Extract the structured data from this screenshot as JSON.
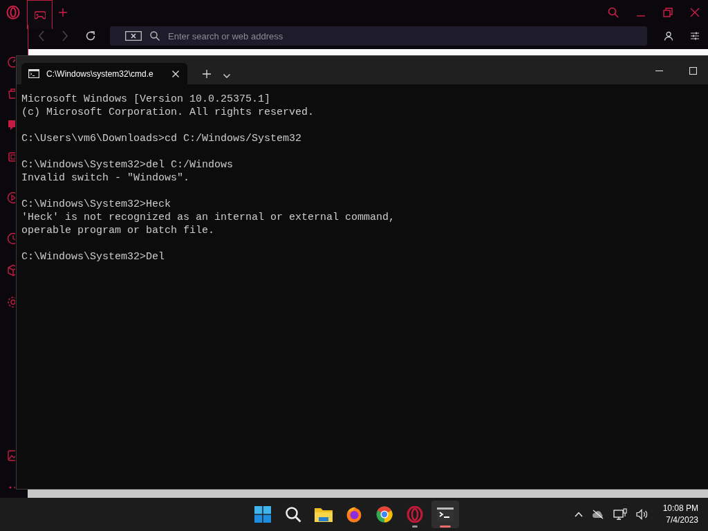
{
  "browser": {
    "address_bar": {
      "placeholder": "Enter search or web address"
    }
  },
  "terminal": {
    "tab": {
      "title": "C:\\Windows\\system32\\cmd.e",
      "selected": true
    },
    "blocks": [
      [
        "Microsoft Windows [Version 10.0.25375.1]",
        "(c) Microsoft Corporation. All rights reserved."
      ],
      [
        "C:\\Users\\vm6\\Downloads>cd C:/Windows/System32"
      ],
      [
        "C:\\Windows\\System32>del C:/Windows",
        "Invalid switch - \"Windows\"."
      ],
      [
        "C:\\Windows\\System32>Heck",
        "'Heck' is not recognized as an internal or external command,",
        "operable program or batch file."
      ],
      [
        "C:\\Windows\\System32>Del"
      ]
    ]
  },
  "taskbar": {
    "apps": [
      {
        "kind": "start",
        "running": false,
        "selected": false
      },
      {
        "kind": "search",
        "running": false,
        "selected": false
      },
      {
        "kind": "folder",
        "running": false,
        "selected": false
      },
      {
        "kind": "firefox",
        "running": false,
        "selected": false
      },
      {
        "kind": "chrome",
        "running": false,
        "selected": false
      },
      {
        "kind": "opera",
        "running": true,
        "selected": false
      },
      {
        "kind": "terminal",
        "running": true,
        "selected": true
      }
    ],
    "clock": {
      "time": "10:08 PM",
      "date": "7/4/2023"
    }
  }
}
